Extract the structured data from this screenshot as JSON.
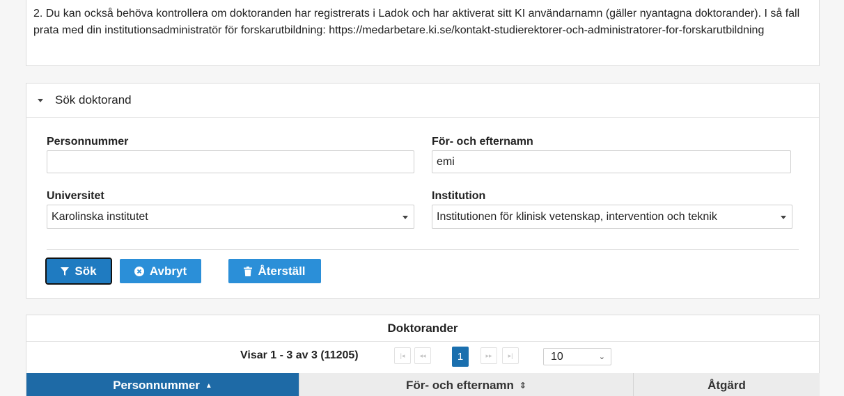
{
  "info": {
    "text": "2. Du kan också behöva kontrollera om doktoranden har registrerats i Ladok och har aktiverat sitt KI användarnamn (gäller nyantagna doktorander). I så fall prata med din institutionsadministratör för forskarutbildning: https://medarbetare.ki.se/kontakt-studierektorer-och-administratorer-for-forskarutbildning"
  },
  "search": {
    "header": "Sök doktorand",
    "personnummer_label": "Personnummer",
    "personnummer_value": "",
    "namn_label": "För- och efternamn",
    "namn_value": "emi",
    "universitet_label": "Universitet",
    "universitet_value": "Karolinska institutet",
    "institution_label": "Institution",
    "institution_value": "Institutionen för klinisk vetenskap, intervention och teknik",
    "btn_sok": "Sök",
    "btn_avbryt": "Avbryt",
    "btn_aterstall": "Återställ"
  },
  "results": {
    "title": "Doktorander",
    "status": "Visar 1 - 3 av 3  (11205)",
    "current_page": "1",
    "rows_per_page": "10",
    "columns": [
      "Personnummer",
      "För- och efternamn",
      "Åtgärd"
    ]
  }
}
